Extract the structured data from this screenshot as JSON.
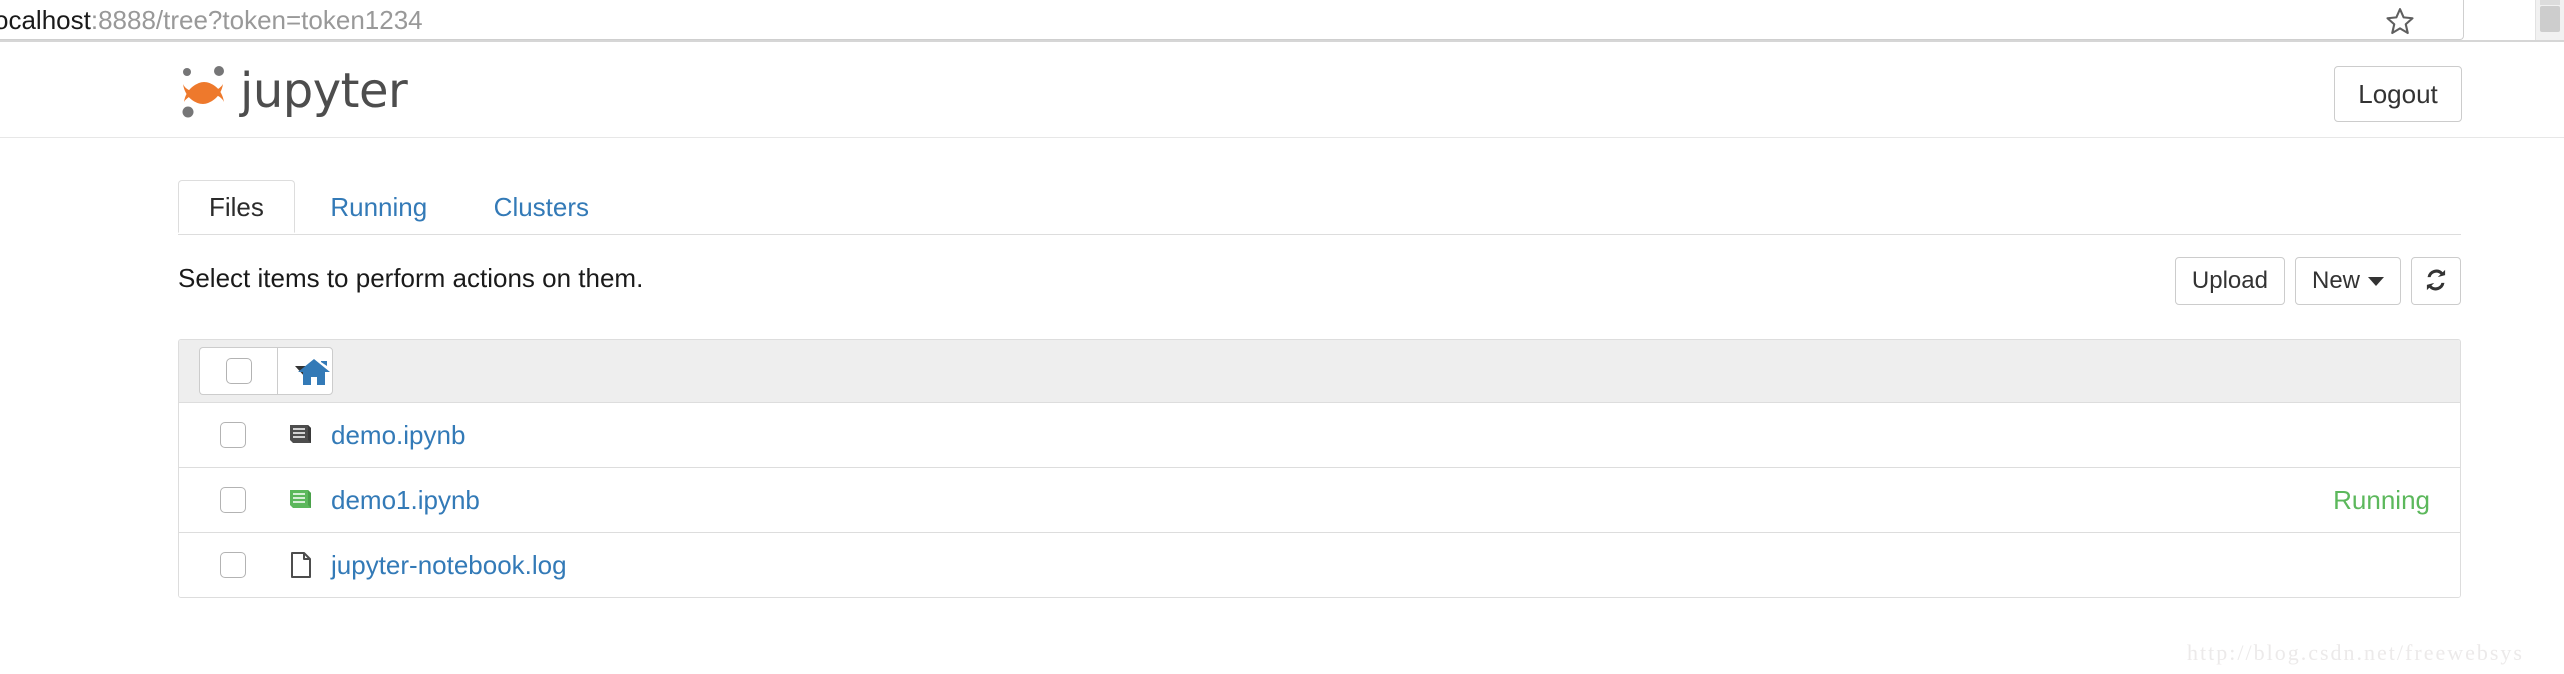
{
  "browser": {
    "url_host": "ocalhost",
    "url_rest": ":8888/tree?token=token1234",
    "bookmark_icon": "star-icon"
  },
  "header": {
    "logo_text": "jupyter",
    "logo_icon": "jupyter-logo-icon",
    "logout_label": "Logout"
  },
  "tabs": [
    {
      "label": "Files",
      "active": true
    },
    {
      "label": "Running",
      "active": false
    },
    {
      "label": "Clusters",
      "active": false
    }
  ],
  "actions": {
    "hint": "Select items to perform actions on them.",
    "upload_label": "Upload",
    "new_label": "New",
    "refresh_icon": "refresh-icon"
  },
  "list_toolbar": {
    "select_all_icon": "checkbox-icon",
    "dropdown_icon": "caret-down-icon",
    "breadcrumb_icon": "home-icon"
  },
  "files": [
    {
      "name": "demo.ipynb",
      "icon": "notebook-icon",
      "icon_color": "#4d4d4d",
      "status": ""
    },
    {
      "name": "demo1.ipynb",
      "icon": "notebook-running-icon",
      "icon_color": "#5cb85c",
      "status": "Running"
    },
    {
      "name": "jupyter-notebook.log",
      "icon": "file-icon",
      "icon_color": "#4d4d4d",
      "status": ""
    }
  ],
  "watermark": "http://blog.csdn.net/freewebsys",
  "colors": {
    "link": "#337ab7",
    "running": "#5cb85c",
    "logo_orange": "#ee792c",
    "toolbar_bg": "#eeeeee"
  }
}
